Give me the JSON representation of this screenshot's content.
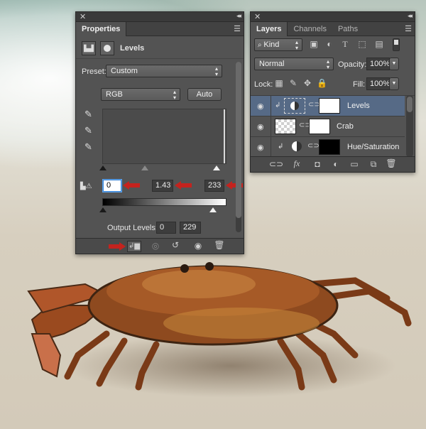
{
  "properties_panel": {
    "tab_label": "Properties",
    "header_title": "Levels",
    "preset_label": "Preset:",
    "preset_value": "Custom",
    "channel_value": "RGB",
    "auto_button": "Auto",
    "input_black": "0",
    "input_gamma": "1.43",
    "input_white": "233",
    "output_label": "Output Levels:",
    "output_black": "0",
    "output_white": "229"
  },
  "layers_panel": {
    "tabs": [
      "Layers",
      "Channels",
      "Paths"
    ],
    "filter_kind": "Kind",
    "blend_mode": "Normal",
    "opacity_label": "Opacity:",
    "opacity_value": "100%",
    "lock_label": "Lock:",
    "fill_label": "Fill:",
    "fill_value": "100%",
    "layers": [
      {
        "name": "Levels",
        "selected": true
      },
      {
        "name": "Crab",
        "selected": false
      },
      {
        "name": "Hue/Saturation",
        "selected": false
      }
    ]
  },
  "colors": {
    "panel_bg": "#535353",
    "selected_row": "#566a86",
    "annotation_arrow": "#c4231e"
  }
}
